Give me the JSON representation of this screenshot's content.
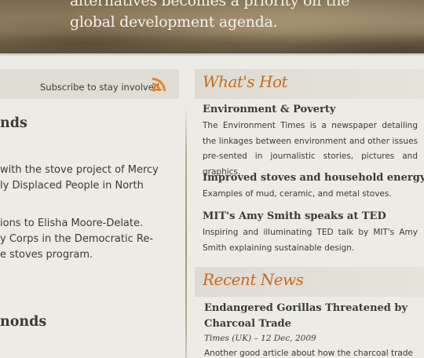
{
  "banner": {
    "line1": "alternatives becomes a priority on the",
    "line2": "global development agenda."
  },
  "left": {
    "subscribe_text": "Subscribe to stay involved.",
    "heading1": "nds",
    "para1": [
      "with the stove project of Mercy",
      "ly Displaced People in North"
    ],
    "para2": [
      "ions to Elisha Moore-Delate.",
      "y Corps in the Democratic Re-",
      "e stoves program."
    ],
    "heading2": "nonds"
  },
  "whats_hot": {
    "title": "What's Hot",
    "items": [
      {
        "title": "Environment & Poverty",
        "desc": "The Environment Times is a newspaper detailing the linkages between environment and other issues pre-sented in journalistic stories, pictures and graphics."
      },
      {
        "title": "Improved stoves and household energy",
        "desc": "Examples of mud, ceramic, and metal stoves."
      },
      {
        "title": "MIT's Amy Smith speaks at TED",
        "desc": "Inspiring and illuminating TED talk by MIT's Amy Smith explaining sustainable design."
      }
    ]
  },
  "recent_news": {
    "title": "Recent News",
    "items": [
      {
        "title": "Endangered Gorillas Threatened by Charcoal Trade",
        "meta": "Times (UK) – 12 Dec, 2009",
        "desc": "Another good article about how the charcoal trade"
      }
    ]
  },
  "colors": {
    "accent": "#c56b1f",
    "rss": "#e8822a"
  },
  "icons": {
    "rss": "rss-icon"
  }
}
